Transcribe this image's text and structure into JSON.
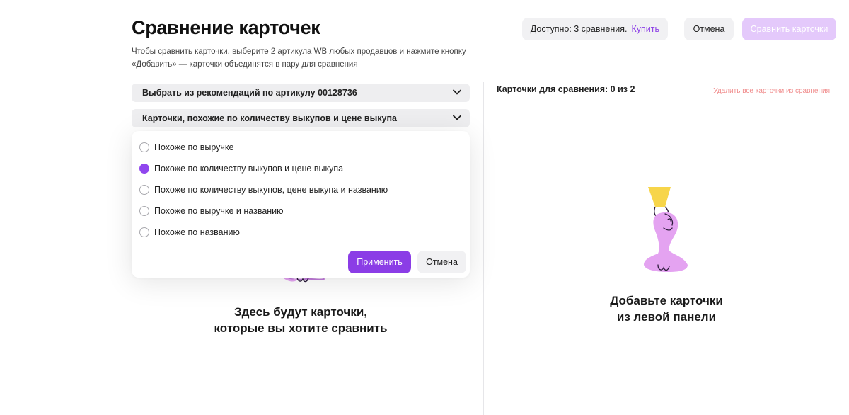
{
  "header": {
    "title": "Сравнение карточек",
    "subtitle": "Чтобы сравнить карточки, выберите 2 артикула WB любых продавцов и нажмите кнопку «Добавить» — карточки объединятся в пару для сравнения"
  },
  "top_actions": {
    "available_label": "Доступно: 3 сравнения.",
    "buy_label": "Купить",
    "cancel_label": "Отмена",
    "compare_label": "Сравнить карточки"
  },
  "left_panel": {
    "select_recommendations": "Выбрать из рекомендаций по артикулу 00128736",
    "select_similarity": "Карточки, похожие по количеству выкупов и цене выкупа",
    "empty_line1": "Здесь будут карточки,",
    "empty_line2": "которые вы хотите сравнить"
  },
  "dropdown": {
    "options": [
      {
        "label": "Похоже по выручке",
        "selected": false
      },
      {
        "label": "Похоже по количеству выкупов и цене выкупа",
        "selected": true
      },
      {
        "label": "Похоже по количеству выкупов, цене выкупа и названию",
        "selected": false
      },
      {
        "label": "Похоже по выручке и названию",
        "selected": false
      },
      {
        "label": "Похоже по названию",
        "selected": false
      }
    ],
    "apply_label": "Применить",
    "cancel_label": "Отмена"
  },
  "right_panel": {
    "title": "Карточки для сравнения: 0 из 2",
    "delete_all_label": "Удалить все карточки из сравнения",
    "empty_line1": "Добавьте карточки",
    "empty_line2": "из левой панели"
  },
  "colors": {
    "accent": "#8b3de6",
    "accent_disabled": "#e4c9fb",
    "danger_link": "#f08b8b",
    "illustration_pink": "#e4a3f1",
    "illustration_yellow": "#f7d54a"
  }
}
